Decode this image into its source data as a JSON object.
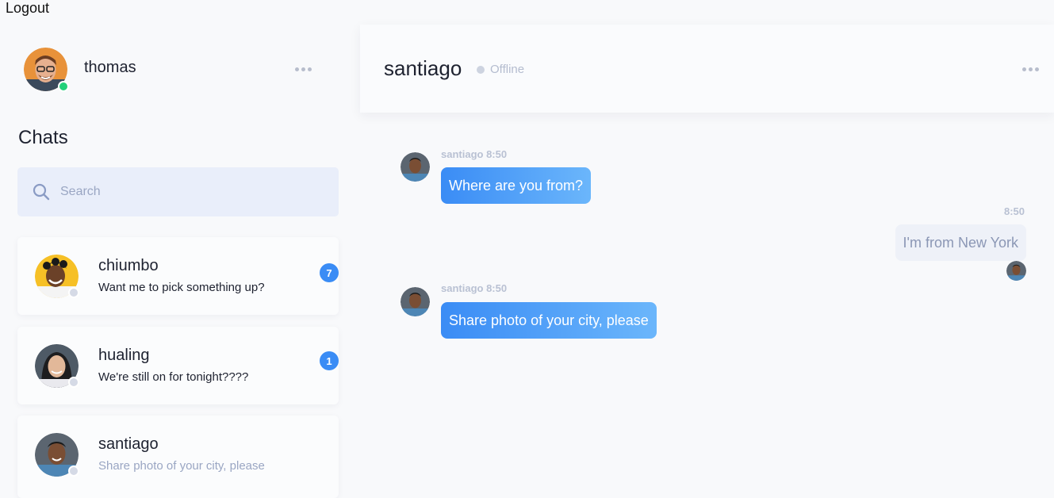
{
  "logout_label": "Logout",
  "me": {
    "name": "thomas",
    "status": "online"
  },
  "sidebar": {
    "title": "Chats",
    "search_placeholder": "Search",
    "chats": [
      {
        "name": "chiumbo",
        "preview": "Want me to pick something up?",
        "unread": "7"
      },
      {
        "name": "hualing",
        "preview": "We're still on for tonight????",
        "unread": "1"
      },
      {
        "name": "santiago",
        "preview": "Share photo of your city, please",
        "unread": ""
      }
    ]
  },
  "conversation": {
    "contact_name": "santiago",
    "contact_status": "Offline",
    "messages": [
      {
        "direction": "in",
        "meta": "santiago 8:50",
        "text": "Where are you from?"
      },
      {
        "direction": "out",
        "meta": "8:50",
        "text": "I'm from New York"
      },
      {
        "direction": "in",
        "meta": "santiago 8:50",
        "text": "Share photo of your city, please"
      }
    ]
  },
  "colors": {
    "accent": "#3a8cf5",
    "online": "#22d17a",
    "offline": "#cdd3e0",
    "background": "#f8f9fb"
  }
}
